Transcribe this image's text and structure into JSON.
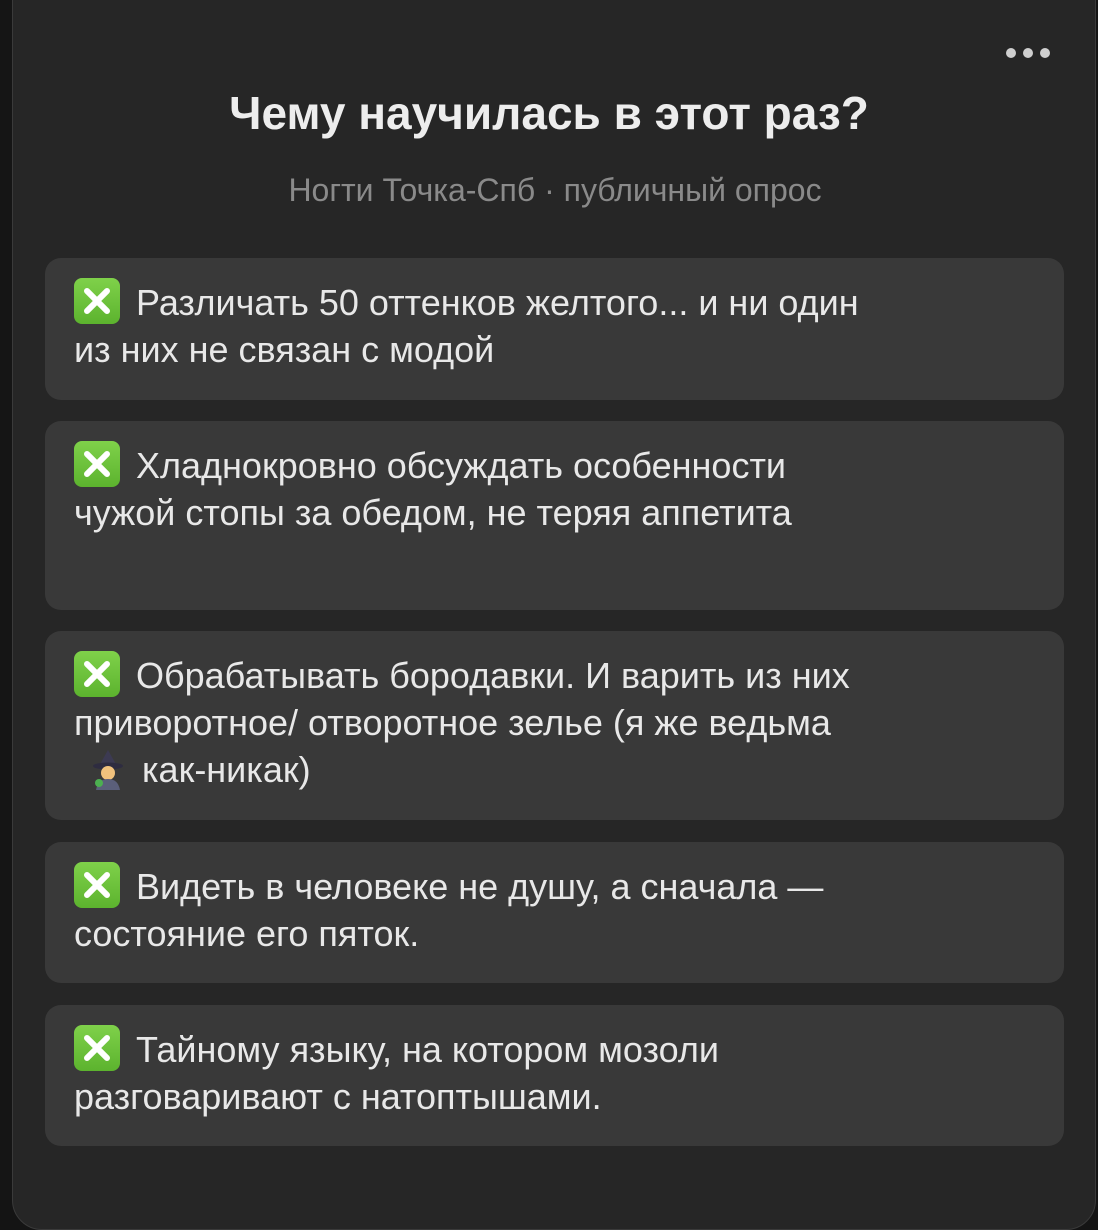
{
  "poll": {
    "title": "Чему научилась в этот раз?",
    "subtitle": "Ногти Точка-Спб · публичный опрос",
    "options": [
      {
        "icon": "cross-mark-icon",
        "text": "Различать 50 оттенков желтого... и ни один из них не связан с модой"
      },
      {
        "icon": "cross-mark-icon",
        "text": "Хладнокровно обсуждать особенности чужой стопы за обедом, не теряя аппетита"
      },
      {
        "icon": "cross-mark-icon",
        "text_before_emoji": "Обрабатывать бородавки.  И варить из них приворотное/ отворотное зелье (я же ведьма",
        "emoji": "witch-emoji-icon",
        "text_after_emoji": "как-никак)"
      },
      {
        "icon": "cross-mark-icon",
        "text": "Видеть в человеке не душу, а сначала — состояние его пяток."
      },
      {
        "icon": "cross-mark-icon",
        "text": "Тайному языку, на котором мозоли разговаривают с натоптышами."
      }
    ]
  },
  "colors": {
    "background": "#141414",
    "card": "#262626",
    "option_background": "#393939",
    "title": "#ededed",
    "subtitle": "#8a8a8a",
    "cross_icon_green": "#6cc23a"
  }
}
